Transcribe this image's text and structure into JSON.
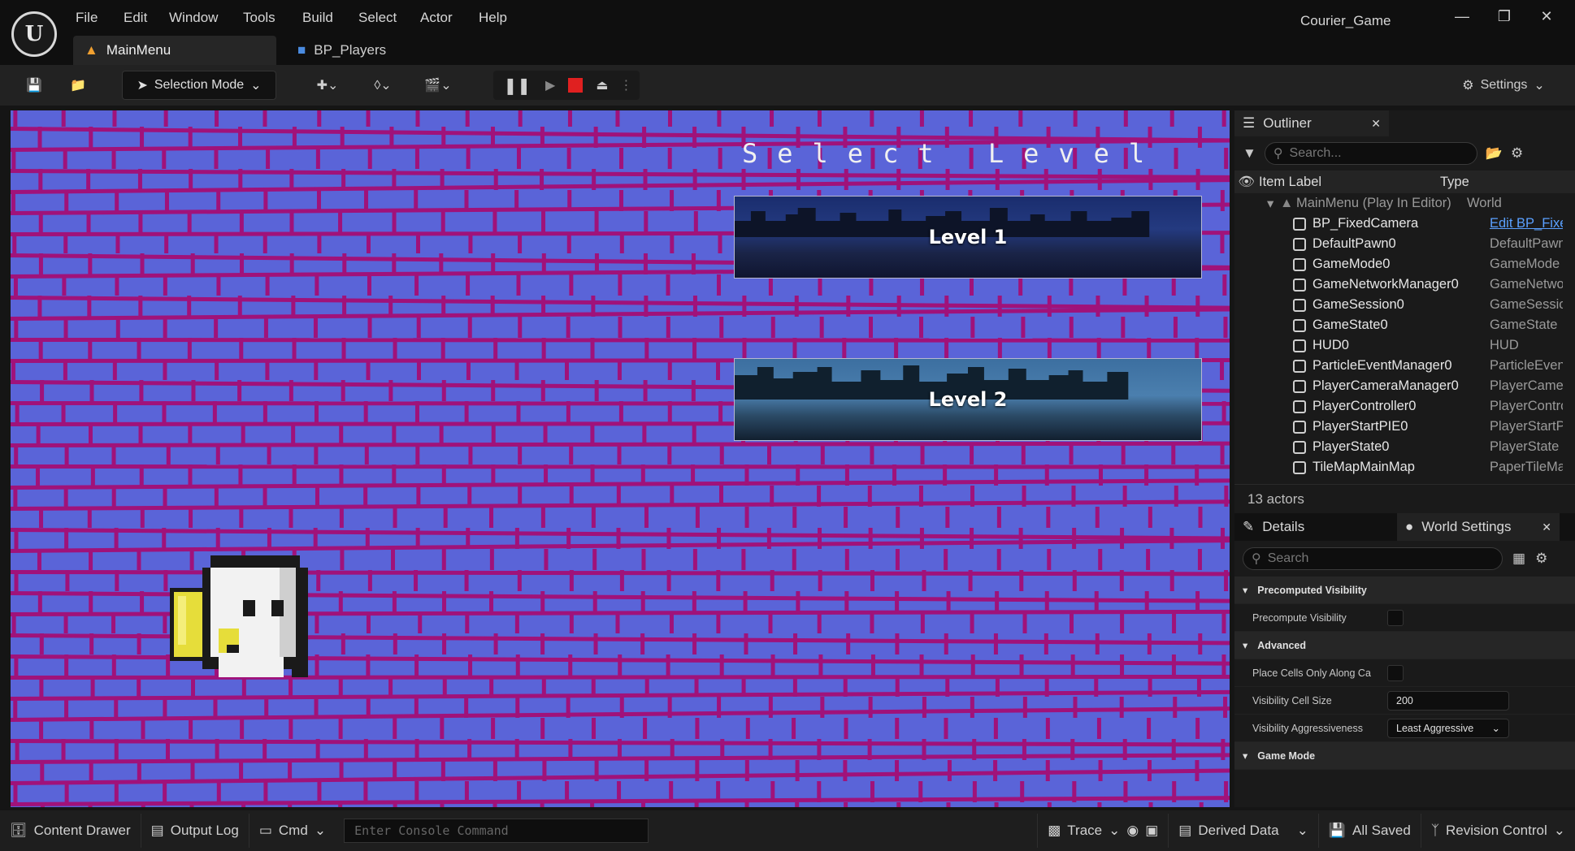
{
  "menu": [
    "File",
    "Edit",
    "Window",
    "Tools",
    "Build",
    "Select",
    "Actor",
    "Help"
  ],
  "project_name": "Courier_Game",
  "tabs": [
    {
      "label": "MainMenu"
    },
    {
      "label": "BP_Players"
    }
  ],
  "toolbar": {
    "selection_mode": "Selection Mode",
    "settings": "Settings"
  },
  "viewport": {
    "title": "Select Level",
    "buttons": [
      {
        "label": "Level 1"
      },
      {
        "label": "Level 2"
      }
    ],
    "colors": {
      "bricks": "#a0127a",
      "background": "#5a64d8"
    }
  },
  "outliner": {
    "title": "Outliner",
    "search_placeholder": "Search...",
    "col_label": "Item Label",
    "col_type": "Type",
    "root": {
      "label": "MainMenu (Play In Editor)",
      "type": "World"
    },
    "items": [
      {
        "label": "BP_FixedCamera",
        "type": "Edit BP_Fixe",
        "icon": "camera-icon"
      },
      {
        "label": "DefaultPawn0",
        "type": "DefaultPawn",
        "icon": "pawn-icon"
      },
      {
        "label": "GameMode0",
        "type": "GameMode",
        "icon": "gamemode-icon"
      },
      {
        "label": "GameNetworkManager0",
        "type": "GameNetwor",
        "icon": "actor-icon"
      },
      {
        "label": "GameSession0",
        "type": "GameSessio",
        "icon": "actor-icon"
      },
      {
        "label": "GameState0",
        "type": "GameState",
        "icon": "gamestate-icon"
      },
      {
        "label": "HUD0",
        "type": "HUD",
        "icon": "hud-icon"
      },
      {
        "label": "ParticleEventManager0",
        "type": "ParticleEvent",
        "icon": "actor-icon"
      },
      {
        "label": "PlayerCameraManager0",
        "type": "PlayerCamer",
        "icon": "actor-icon"
      },
      {
        "label": "PlayerController0",
        "type": "PlayerContrc",
        "icon": "controller-icon"
      },
      {
        "label": "PlayerStartPIE0",
        "type": "PlayerStartP",
        "icon": "flag-icon"
      },
      {
        "label": "PlayerState0",
        "type": "PlayerState",
        "icon": "actor-icon"
      },
      {
        "label": "TileMapMainMap",
        "type": "PaperTileMa",
        "icon": "tilemap-icon"
      }
    ],
    "actor_count": "13 actors"
  },
  "details": {
    "tab_details": "Details",
    "tab_world": "World Settings",
    "search_placeholder": "Search",
    "rows": [
      {
        "kind": "section",
        "label": "Precomputed Visibility"
      },
      {
        "kind": "check",
        "label": "Precompute Visibility"
      },
      {
        "kind": "section",
        "label": "Advanced"
      },
      {
        "kind": "check",
        "label": "Place Cells Only Along Ca..."
      },
      {
        "kind": "value",
        "label": "Visibility Cell Size",
        "value": "200"
      },
      {
        "kind": "select",
        "label": "Visibility Aggressiveness",
        "value": "Least Aggressive"
      },
      {
        "kind": "section",
        "label": "Game Mode"
      }
    ]
  },
  "status": {
    "content_drawer": "Content Drawer",
    "output_log": "Output Log",
    "cmd": "Cmd",
    "console_placeholder": "Enter Console Command",
    "trace": "Trace",
    "derived_data": "Derived Data",
    "all_saved": "All Saved",
    "revision_control": "Revision Control"
  }
}
